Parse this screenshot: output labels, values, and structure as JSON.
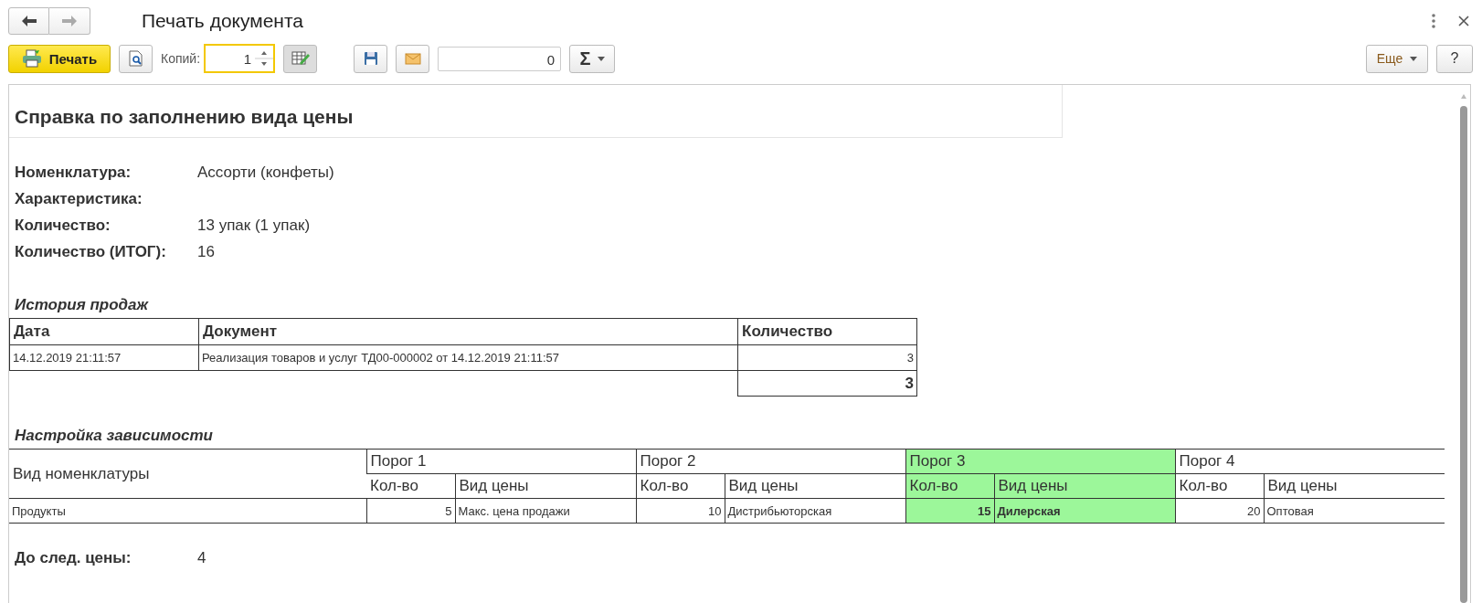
{
  "window": {
    "title": "Печать документа"
  },
  "toolbar": {
    "print_button": "Печать",
    "copies_label": "Копий:",
    "copies_value": "1",
    "sum_value": "0",
    "sum_symbol": "Σ",
    "more_button": "Еще",
    "help_button": "?"
  },
  "report": {
    "title": "Справка по заполнению вида цены",
    "fields": [
      {
        "label": "Номенклатура:",
        "value": "Ассорти (конфеты)"
      },
      {
        "label": "Характеристика:"
      },
      {
        "label": "Количество:",
        "value": "13 упак (1 упак)"
      },
      {
        "label": "Количество (ИТОГ):",
        "value": "16"
      }
    ],
    "sales_history": {
      "title": "История продаж",
      "columns": [
        "Дата",
        "Документ",
        "Количество"
      ],
      "rows": [
        {
          "date": "14.12.2019 21:11:57",
          "document": "Реализация товаров и услуг ТД00-000002 от 14.12.2019 21:11:57",
          "quantity": "3"
        }
      ],
      "total": "3"
    },
    "dependency": {
      "title": "Настройка зависимости",
      "first_column": "Вид номенклатуры",
      "row_label": "Продукты",
      "thresholds": [
        {
          "label": "Порог 1",
          "qty_header": "Кол-во",
          "price_header": "Вид цены",
          "quantity": "5",
          "price_type": "Макс. цена продажи",
          "selected": false
        },
        {
          "label": "Порог 2",
          "qty_header": "Кол-во",
          "price_header": "Вид цены",
          "quantity": "10",
          "price_type": "Дистрибьюторская",
          "selected": false
        },
        {
          "label": "Порог 3",
          "qty_header": "Кол-во",
          "price_header": "Вид цены",
          "quantity": "15",
          "price_type": "Дилерская",
          "selected": true
        },
        {
          "label": "Порог 4",
          "qty_header": "Кол-во",
          "price_header": "Вид цены",
          "quantity": "20",
          "price_type": "Оптовая",
          "selected": false
        }
      ]
    },
    "next_price": {
      "label": "До след. цены:",
      "value": "4"
    }
  }
}
